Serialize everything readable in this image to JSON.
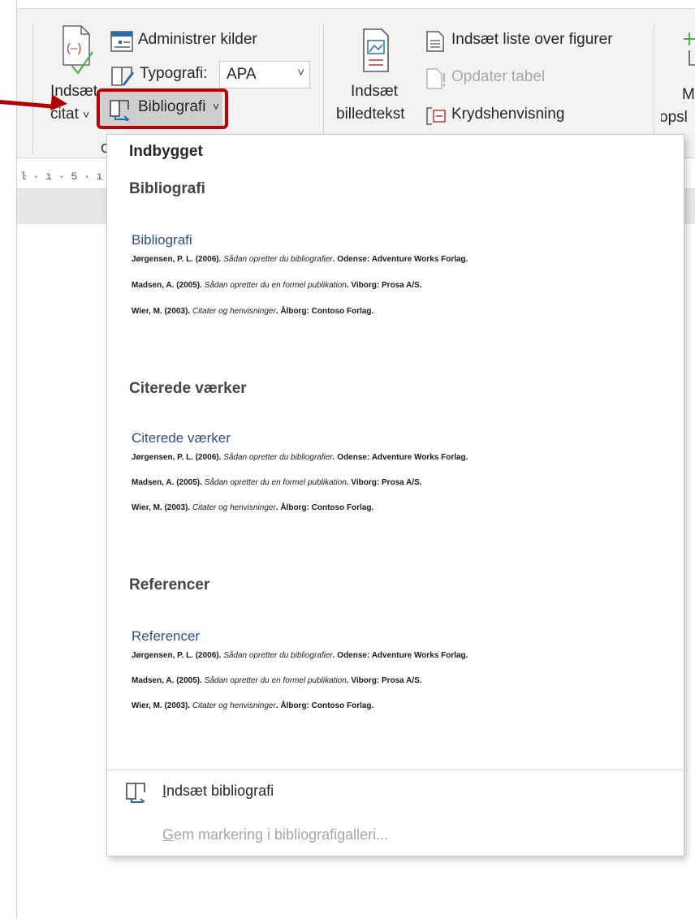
{
  "ribbon": {
    "insert_citation": {
      "line1": "Indsæt",
      "line2": "citat",
      "chevron": "˅"
    },
    "manage_sources": "Administrer kilder",
    "style_label": "Typografi:",
    "style_value": "APA",
    "style_chevron": "˅",
    "bibliography_button": "Bibliografi",
    "bibliography_chevron": "˅",
    "group_letter": "C",
    "insert_caption": {
      "line1": "Indsæt",
      "line2": "billedtekst"
    },
    "insert_table_of_figures": "Indsæt liste over figurer",
    "update_table": "Opdater tabel",
    "cross_reference": "Krydshenvisning",
    "cut_off_button": {
      "line1": "M",
      "line2": "opsl"
    }
  },
  "ruler": {
    "text": "ŀ · ı · 5 · ı"
  },
  "dropdown": {
    "header": "Indbygget",
    "sections": [
      {
        "title": "Bibliografi",
        "gallery_title": "Bibliografi",
        "entries": [
          {
            "author": "Jørgensen, P. L. (2006). ",
            "work": "Sådan opretter du bibliografier",
            "rest": ". Odense: Adventure Works Forlag."
          },
          {
            "author": "Madsen, A. (2005). ",
            "work": "Sådan opretter du en formel publikation",
            "rest": ". Viborg: Prosa A/S."
          },
          {
            "author": "Wier, M. (2003). ",
            "work": "Citater og henvisninger",
            "rest": ". Ålborg: Contoso Forlag."
          }
        ]
      },
      {
        "title": "Citerede værker",
        "gallery_title": "Citerede værker",
        "entries": [
          {
            "author": "Jørgensen, P. L. (2006). ",
            "work": "Sådan opretter du bibliografier",
            "rest": ". Odense: Adventure Works Forlag."
          },
          {
            "author": "Madsen, A. (2005). ",
            "work": "Sådan opretter du en formel publikation",
            "rest": ". Viborg: Prosa A/S."
          },
          {
            "author": "Wier, M. (2003). ",
            "work": "Citater og henvisninger",
            "rest": ". Ålborg: Contoso Forlag."
          }
        ]
      },
      {
        "title": "Referencer",
        "gallery_title": "Referencer",
        "entries": [
          {
            "author": "Jørgensen, P. L. (2006). ",
            "work": "Sådan opretter du bibliografier",
            "rest": ". Odense: Adventure Works Forlag."
          },
          {
            "author": "Madsen, A. (2005). ",
            "work": "Sådan opretter du en formel publikation",
            "rest": ". Viborg: Prosa A/S."
          },
          {
            "author": "Wier, M. (2003). ",
            "work": "Citater og henvisninger",
            "rest": ". Ålborg: Contoso Forlag."
          }
        ]
      }
    ],
    "insert_bibliography": {
      "underlined": "I",
      "rest": "ndsæt bibliografi"
    },
    "save_selection": {
      "underlined": "G",
      "rest": "em markering i bibliografigalleri..."
    }
  },
  "colors": {
    "highlight_outline": "#c00000",
    "arrow": "#b00000",
    "gallery_title": "#2e4e8f",
    "citation_icon_red": "#c0392b",
    "citation_icon_green": "#4caf50"
  }
}
